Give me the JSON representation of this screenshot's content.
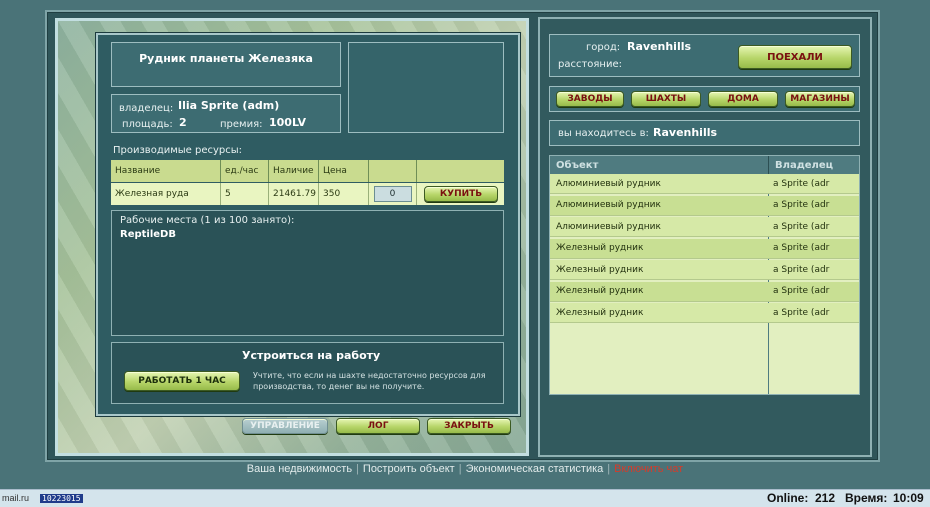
{
  "mine": {
    "title": "Рудник планеты Железяка",
    "owner_label": "владелец:",
    "owner": "Ilia Sprite (adm)",
    "area_label": "площадь:",
    "area": "2",
    "bonus_label": "премия:",
    "bonus": "100LV"
  },
  "resources": {
    "caption": "Производимые ресурсы:",
    "headers": [
      "Название",
      "ед./час",
      "Наличие",
      "Цена"
    ],
    "row": {
      "name": "Железная руда",
      "per_hour": "5",
      "stock": "21461.79",
      "price": "350",
      "qty": "0",
      "buy_label": "КУПИТЬ"
    }
  },
  "workplaces": {
    "caption": "Рабочие места (1 из 100 занято):",
    "workers": [
      "ReptileDB"
    ]
  },
  "job": {
    "title": "Устроиться на работу",
    "work_button": "РАБОТАТЬ 1 ЧАС",
    "note": "Учтите, что если на шахте недостаточно ресурсов для производства, то денег вы не получите."
  },
  "bottom_buttons": {
    "manage": "УПРАВЛЕНИЕ",
    "log": "ЛОГ",
    "close": "ЗАКРЫТЬ"
  },
  "travel": {
    "city_label": "город:",
    "city": "Ravenhills",
    "distance_label": "расстояние:",
    "go_button": "ПОЕХАЛИ"
  },
  "categories": [
    "ЗАВОДЫ",
    "ШАХТЫ",
    "ДОМА",
    "МАГАЗИНЫ"
  ],
  "location": {
    "label": "вы находитесь в:",
    "city": "Ravenhills"
  },
  "objects": {
    "headers": [
      "Объект",
      "Владелец"
    ],
    "rows": [
      {
        "name": "Алюминиевый рудник",
        "owner": "a Sprite (adr"
      },
      {
        "name": "Алюминиевый рудник",
        "owner": "a Sprite (adr"
      },
      {
        "name": "Алюминиевый рудник",
        "owner": "a Sprite (adr"
      },
      {
        "name": "Железный рудник",
        "owner": "a Sprite (adr"
      },
      {
        "name": "Железный рудник",
        "owner": "a Sprite (adr"
      },
      {
        "name": "Железный рудник",
        "owner": "a Sprite (adr"
      },
      {
        "name": "Железный рудник",
        "owner": "a Sprite (adr"
      }
    ]
  },
  "footer": {
    "links": [
      "Ваша недвижимость",
      "Построить объект",
      "Экономическая статистика"
    ],
    "chat": "Включить чат"
  },
  "status": {
    "site": "mail.ru",
    "counter": "10223015",
    "online_label": "Online:",
    "online": "212",
    "time_label": "Время:",
    "time": "10:09"
  },
  "colors": {
    "panel": "#2f5c62",
    "button_green": "#b7d569",
    "button_text": "#7a1010",
    "row_light": "#d6e9a7",
    "chat_red": "#d63b2a"
  }
}
